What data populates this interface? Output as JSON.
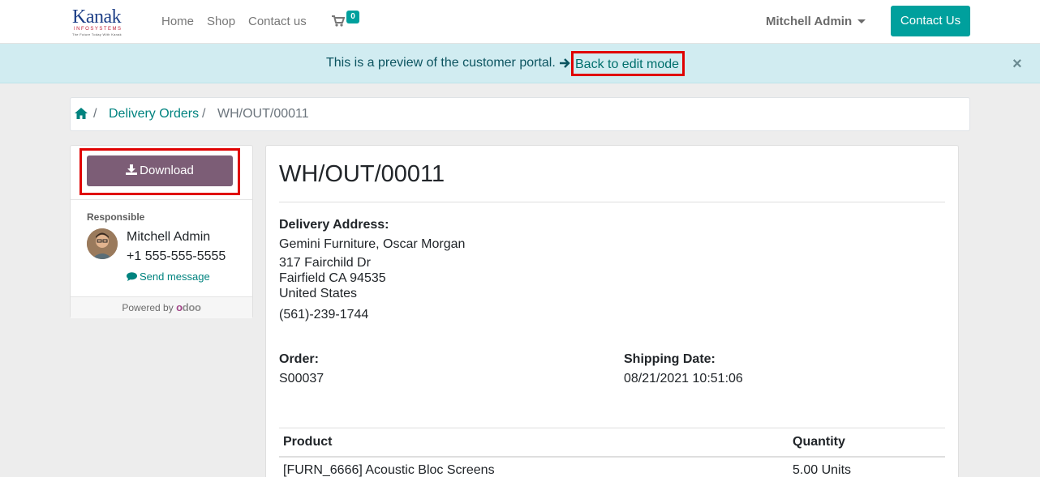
{
  "navbar": {
    "logo": {
      "main": "Kanak",
      "sub": "INFOSYSTEMS",
      "tag": "The Future Today With Kanak"
    },
    "links": [
      "Home",
      "Shop",
      "Contact us"
    ],
    "cart_count": "0",
    "user": "Mitchell Admin",
    "contact_button": "Contact Us"
  },
  "alert": {
    "text": "This is a preview of the customer portal.",
    "edit_link": "Back to edit mode",
    "close": "×"
  },
  "breadcrumb": {
    "sep": "/",
    "link": "Delivery Orders",
    "active": "WH/OUT/00011"
  },
  "sidebar": {
    "download_label": "Download",
    "responsible_label": "Responsible",
    "name": "Mitchell Admin",
    "phone": "+1 555-555-5555",
    "send_message": "Send message",
    "powered_by": "Powered by",
    "odoo_o": "o",
    "odoo_rest": "doo"
  },
  "document": {
    "title": "WH/OUT/00011",
    "delivery_address_label": "Delivery Address:",
    "address": [
      "Gemini Furniture, Oscar Morgan",
      "317 Fairchild Dr",
      "Fairfield CA 94535",
      "United States"
    ],
    "phone": "(561)-239-1744",
    "order_label": "Order:",
    "order_value": "S00037",
    "shipping_date_label": "Shipping Date:",
    "shipping_date_value": "08/21/2021 10:51:06",
    "table": {
      "headers": [
        "Product",
        "Quantity"
      ],
      "rows": [
        [
          "[FURN_6666] Acoustic Bloc Screens",
          "5.00 Units"
        ]
      ]
    }
  },
  "colors": {
    "accent": "#00a09d",
    "download_button": "#7c5d76",
    "alert_bg": "#d1ecf1",
    "highlight": "#e00000"
  }
}
